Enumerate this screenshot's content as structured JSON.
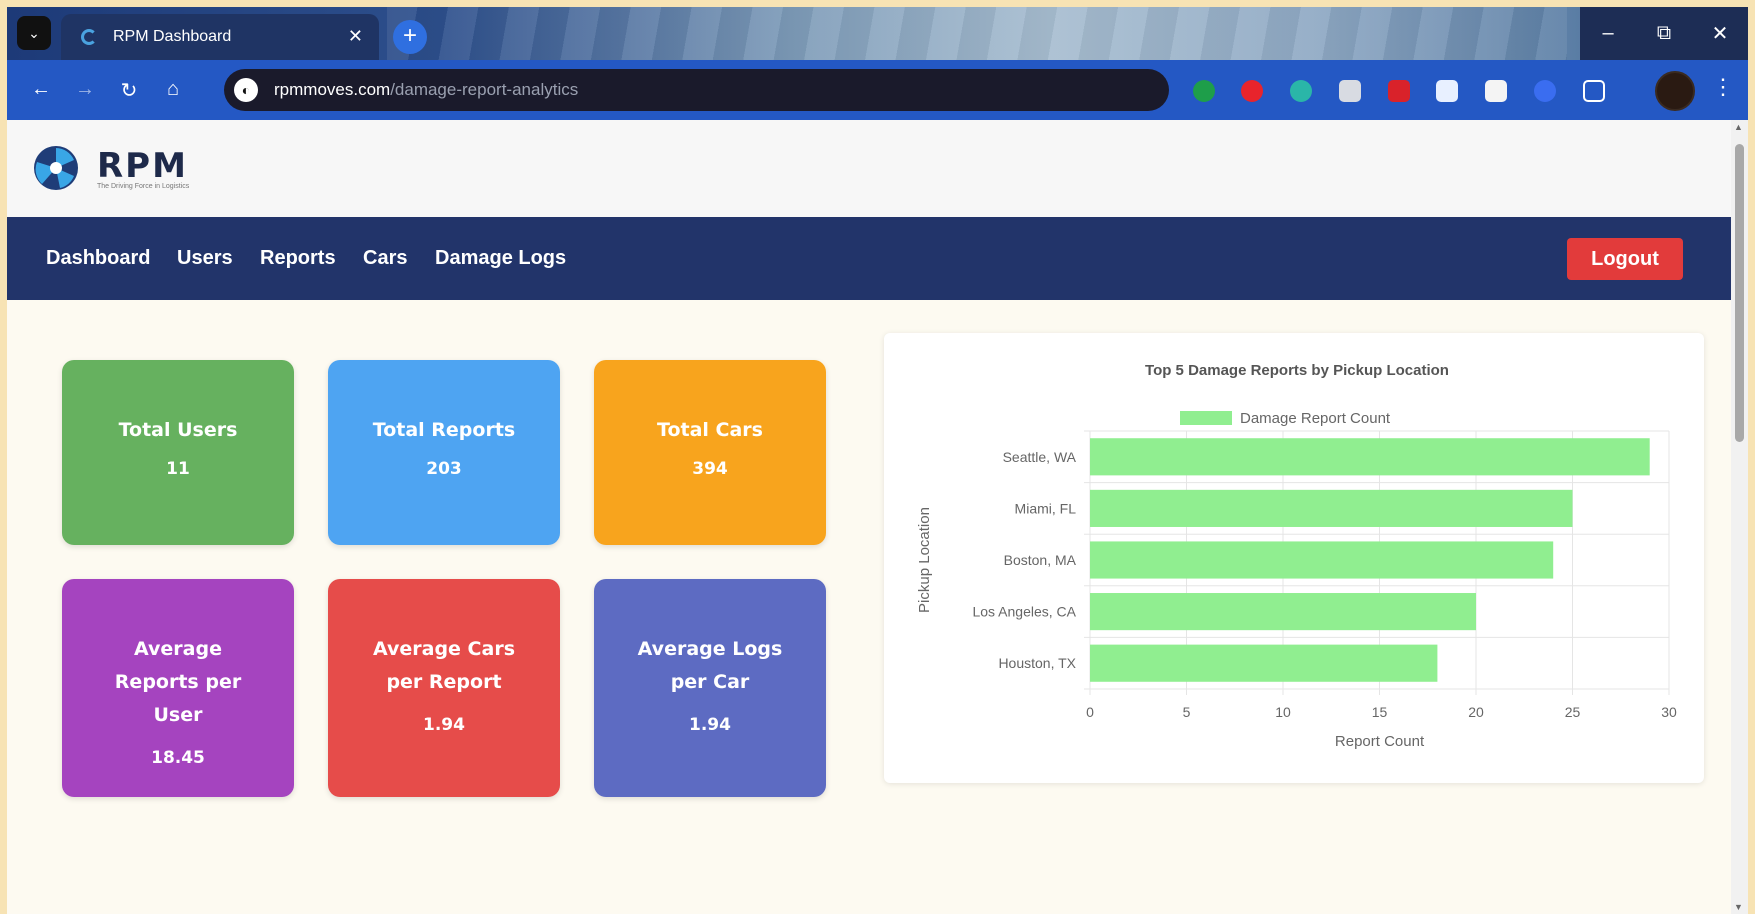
{
  "browser": {
    "tab_title": "RPM Dashboard",
    "url_host": "rpmmoves.com",
    "url_path": "/damage-report-analytics"
  },
  "site": {
    "logo_text": "RPM",
    "logo_tagline": "The Driving Force in Logistics"
  },
  "nav": {
    "items": [
      "Dashboard",
      "Users",
      "Reports",
      "Cars",
      "Damage Logs"
    ],
    "logout_label": "Logout"
  },
  "stats": [
    {
      "title": "Total Users",
      "value": "11",
      "color": "#66b15f"
    },
    {
      "title": "Total Reports",
      "value": "203",
      "color": "#4ea4f2"
    },
    {
      "title": "Total Cars",
      "value": "394",
      "color": "#f8a41d"
    },
    {
      "title": "Average Reports per User",
      "value": "18.45",
      "color": "#a544bf"
    },
    {
      "title": "Average Cars per Report",
      "value": "1.94",
      "color": "#e64c4a"
    },
    {
      "title": "Average Logs per Car",
      "value": "1.94",
      "color": "#5d6bc2"
    }
  ],
  "chart_data": {
    "type": "bar",
    "orientation": "horizontal",
    "title": "Top 5 Damage Reports by Pickup Location",
    "categories": [
      "Seattle, WA",
      "Miami, FL",
      "Boston, MA",
      "Los Angeles, CA",
      "Houston, TX"
    ],
    "series": [
      {
        "name": "Damage Report Count",
        "values": [
          29,
          25,
          24,
          20,
          18
        ],
        "color": "#90ee90"
      }
    ],
    "xlabel": "Report Count",
    "ylabel": "Pickup Location",
    "xlim": [
      0,
      30
    ],
    "xticks": [
      0,
      5,
      10,
      15,
      20,
      25,
      30
    ],
    "grid": true,
    "legend_position": "top"
  }
}
